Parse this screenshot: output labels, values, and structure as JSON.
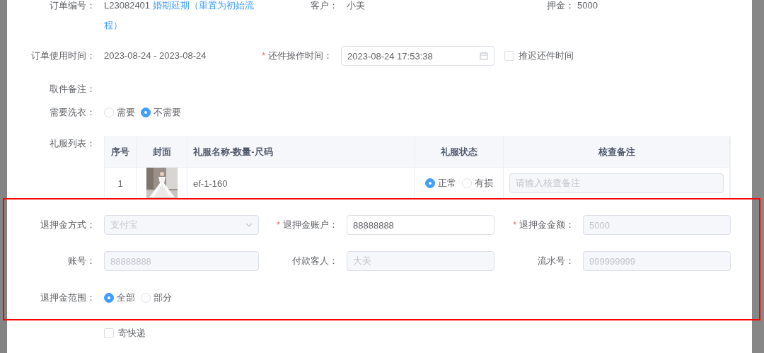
{
  "order": {
    "label": "订单编号：",
    "number": "L23082401",
    "link": "婚期延期（重置为初始流程）",
    "customer_label": "客户：",
    "customer": "小美",
    "deposit_label": "押金：",
    "deposit": "5000"
  },
  "usage": {
    "label": "订单使用时间：",
    "value": "2023-08-24 - 2023-08-24"
  },
  "return_time": {
    "label": "还件操作时间：",
    "required_mark": "*",
    "value": "2023-08-24 17:53:38"
  },
  "delay": {
    "label": "推迟还件时间",
    "checked": false
  },
  "pickup_note": {
    "label": "取件备注："
  },
  "laundry": {
    "label": "需要洗衣：",
    "options": [
      {
        "label": "需要",
        "selected": false
      },
      {
        "label": "不需要",
        "selected": true
      }
    ]
  },
  "dress_list": {
    "label": "礼服列表：",
    "columns": [
      "序号",
      "封面",
      "礼服名称-数量-尺码",
      "礼服状态",
      "核查备注"
    ],
    "rows": [
      {
        "index": "1",
        "name": "ef-1-160",
        "status": [
          {
            "label": "正常",
            "selected": true
          },
          {
            "label": "有损",
            "selected": false
          }
        ],
        "note_placeholder": "请输入核查备注"
      }
    ]
  },
  "refund": {
    "fields": [
      {
        "label": "退押金方式：",
        "kind": "select",
        "value": "支付宝",
        "disabled": true
      },
      {
        "label": "退押金账户：",
        "required_mark": "*",
        "kind": "input",
        "value": "88888888",
        "disabled": false
      },
      {
        "label": "退押金金额：",
        "required_mark": "*",
        "kind": "input",
        "value": "5000",
        "disabled": true
      },
      {
        "label": "账号：",
        "kind": "input",
        "value": "88888888",
        "disabled": true
      },
      {
        "label": "付款客人：",
        "kind": "input",
        "value": "大美",
        "disabled": true
      },
      {
        "label": "流水号：",
        "kind": "input",
        "value": "999999999",
        "disabled": true
      }
    ],
    "range": {
      "label": "退押金范围：",
      "options": [
        {
          "label": "全部",
          "selected": true
        },
        {
          "label": "部分",
          "selected": false
        }
      ]
    }
  },
  "express": {
    "label": "寄快递",
    "checked": false
  }
}
